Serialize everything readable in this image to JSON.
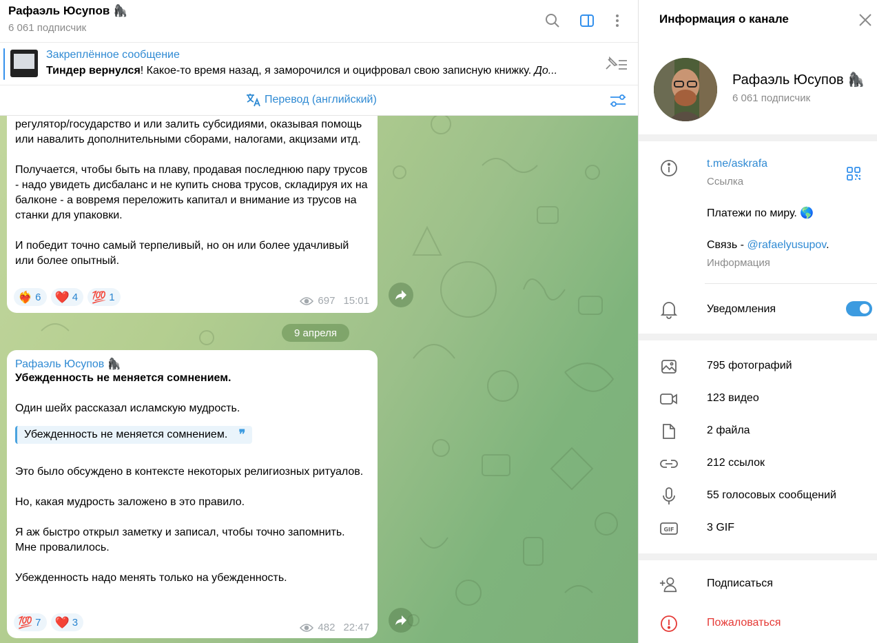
{
  "chat": {
    "title": "Рафаэль Юсупов 🦍",
    "subscribers": "6 061 подписчик",
    "pinned": {
      "title": "Закреплённое сообщение",
      "bold": "Тиндер вернулся",
      "text": "!  Какое-то время назад, я заморочился и оцифровал свою записную книжку. ",
      "italic": "До..."
    },
    "translate_label": "Перевод (английский)",
    "message1": {
      "paragraphs": [
        "регулятор/государство и или залить субсидиями, оказывая помощь или навалить дополнительными сборами, налогами, акцизами  итд.",
        "Получается, чтобы быть на плаву, продавая последнюю пару трусов - надо увидеть дисбаланс и не купить снова трусов, складируя их на балконе - а вовремя переложить капитал и внимание из трусов на станки для упаковки.",
        "И победит точно самый терпеливый, но он или более удачливый или более опытный."
      ],
      "reactions": [
        {
          "emoji": "❤️‍🔥",
          "count": "6"
        },
        {
          "emoji": "❤️",
          "count": "4"
        },
        {
          "emoji": "💯",
          "count": "1"
        }
      ],
      "views": "697",
      "time": "15:01"
    },
    "date_separator": "9 апреля",
    "message2": {
      "author": "Рафаэль Юсупов 🦍",
      "heading": "Убежденность не меняется сомнением.",
      "p1": "Один шейх рассказал  исламскую мудрость.",
      "quote": "Убежденность не меняется сомнением.",
      "p2": "Это было обсуждено в контексте некоторых религиозных ритуалов.",
      "p3": "Но, какая мудрость заложено в это правило.",
      "p4": "Я аж быстро открыл заметку и записал, чтобы точно запомнить. Мне провалилось.",
      "p5": "Убежденность надо менять только на убежденность.",
      "reactions": [
        {
          "emoji": "💯",
          "count": "7"
        },
        {
          "emoji": "❤️",
          "count": "3"
        }
      ],
      "views": "482",
      "time": "22:47"
    }
  },
  "panel": {
    "title": "Информация о канале",
    "name": "Рафаэль Юсупов 🦍",
    "subscribers": "6 061 подписчик",
    "link": "t.me/askrafa",
    "link_caption": "Ссылка",
    "description_line1": "Платежи по миру. 🌎",
    "contact_prefix": "Связь - ",
    "contact_handle": "@rafaelyusupov",
    "contact_suffix": ".",
    "info_caption": "Информация",
    "notifications_label": "Уведомления",
    "notifications_on": true,
    "media": [
      {
        "icon": "photo-icon",
        "label": "795 фотографий"
      },
      {
        "icon": "video-icon",
        "label": "123 видео"
      },
      {
        "icon": "file-icon",
        "label": "2 файла"
      },
      {
        "icon": "link-icon",
        "label": "212 ссылок"
      },
      {
        "icon": "microphone-icon",
        "label": "55 голосовых сообщений"
      },
      {
        "icon": "gif-icon",
        "label": "3 GIF"
      }
    ],
    "subscribe_label": "Подписаться",
    "report_label": "Пожаловаться"
  },
  "colors": {
    "accent": "#3390ec",
    "link": "#2f8ad3",
    "danger": "#e53935",
    "chat_bg": "#a9c98b"
  }
}
